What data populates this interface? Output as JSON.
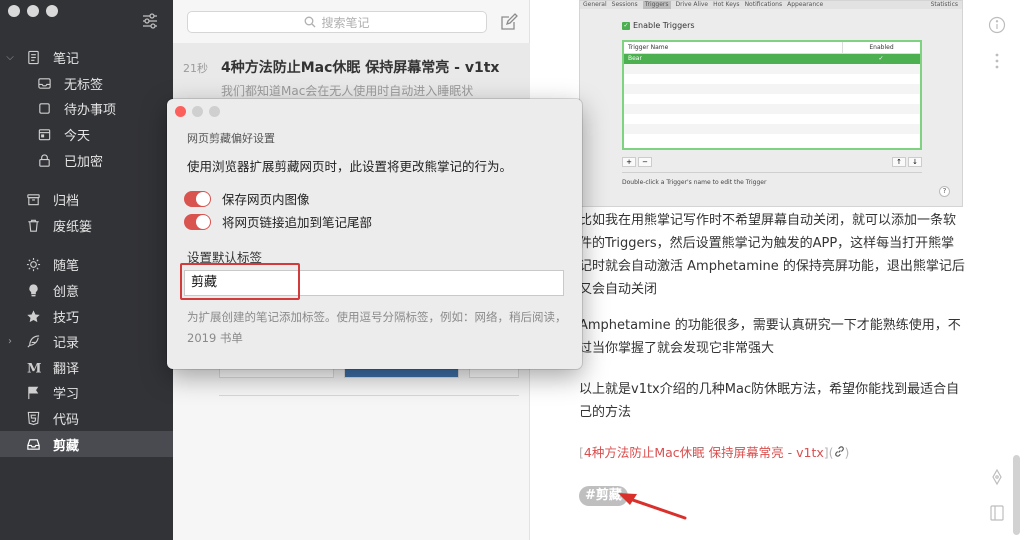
{
  "colors": {
    "sidebar_bg": "#323337",
    "accent_red": "#d9534f",
    "link_red": "#d94f4f",
    "tag_gray": "#bfbfbf"
  },
  "sidebar": {
    "items": [
      {
        "label": "笔记",
        "icon": "note-icon",
        "level": 1,
        "expand": "⌵"
      },
      {
        "label": "无标签",
        "icon": "inbox-icon",
        "level": 2
      },
      {
        "label": "待办事项",
        "icon": "checkbox-icon",
        "level": 2
      },
      {
        "label": "今天",
        "icon": "calendar-icon",
        "level": 2
      },
      {
        "label": "已加密",
        "icon": "lock-icon",
        "level": 2
      },
      {
        "label": "归档",
        "icon": "archive-icon",
        "level": 1
      },
      {
        "label": "废纸篓",
        "icon": "trash-icon",
        "level": 1
      },
      {
        "label": "随笔",
        "icon": "sun-icon",
        "level": 1
      },
      {
        "label": "创意",
        "icon": "bulb-icon",
        "level": 1
      },
      {
        "label": "技巧",
        "icon": "star-icon",
        "level": 1
      },
      {
        "label": "记录",
        "icon": "feather-icon",
        "level": 1,
        "expand": "›"
      },
      {
        "label": "翻译",
        "icon": "medium-icon",
        "level": 1
      },
      {
        "label": "学习",
        "icon": "flag-icon",
        "level": 1
      },
      {
        "label": "代码",
        "icon": "html5-icon",
        "level": 1
      },
      {
        "label": "剪藏",
        "icon": "tray-icon",
        "level": 1
      }
    ]
  },
  "notelist": {
    "search_placeholder": "搜索笔记",
    "note": {
      "time": "21秒",
      "title": "4种方法防止Mac休眠 保持屏幕常亮 - v1tx",
      "excerpt": "我们都知道Mac会在无人使用时自动进入睡眠状"
    }
  },
  "editor": {
    "screenshot": {
      "tabs": [
        "General",
        "Sessions",
        "Triggers",
        "Drive Alive",
        "Hot Keys",
        "Notifications",
        "Appearance"
      ],
      "stats": "Statistics",
      "enable_label": "Enable Triggers",
      "col_name": "Trigger Name",
      "col_enabled": "Enabled",
      "row_name": "Bear",
      "row_check": "✓",
      "btn_add": "+",
      "btn_remove": "−",
      "btn_up": "↑",
      "btn_down": "↓",
      "hint": "Double-click a Trigger's name to edit the Trigger",
      "help": "?"
    },
    "para1": "比如我在用熊掌记写作时不希望屏幕自动关闭，就可以添加一条软件的Triggers，然后设置熊掌记为触发的APP，这样每当打开熊掌记时就会自动激活 Amphetamine 的保持亮屏功能，退出熊掌记后又会自动关闭",
    "para2": "Amphetamine 的功能很多，需要认真研究一下才能熟练使用，不过当你掌握了就会发现它非常强大",
    "para3": "以上就是v1tx介绍的几种Mac防休眠方法，希望你能找到最适合自己的方法",
    "link_open": "[",
    "link_text": "4种方法防止Mac休眠 保持屏幕常亮 - v1tx",
    "link_mid": "](",
    "link_close": ")",
    "tag": "#剪藏"
  },
  "modal": {
    "title": "网页剪藏偏好设置",
    "description": "使用浏览器扩展剪藏网页时，此设置将更改熊掌记的行为。",
    "toggle1": "保存网页内图像",
    "toggle2": "将网页链接追加到笔记尾部",
    "tag_label": "设置默认标签",
    "tag_value": "剪藏",
    "help": "为扩展创建的笔记添加标签。使用逗号分隔标签，例如：网络，稍后阅读，2019 书单"
  }
}
